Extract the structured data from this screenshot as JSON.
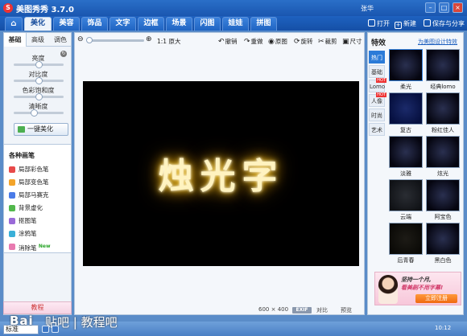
{
  "window": {
    "app_name": "美图秀秀 3.7.0",
    "user": "张华",
    "logo_glyph": "S",
    "minimize": "–",
    "maximize": "□",
    "close": "×"
  },
  "nav": {
    "home_icon": "⌂",
    "tabs": [
      "美化",
      "美容",
      "饰品",
      "文字",
      "边框",
      "场景",
      "闪图",
      "娃娃",
      "拼图"
    ],
    "active_tab": "美化",
    "open_label": "打开",
    "new_label": "新建",
    "save_label": "保存与分享"
  },
  "left": {
    "subtabs": [
      "基础",
      "高级",
      "调色"
    ],
    "sliders": [
      {
        "label": "亮度",
        "value": 0.5
      },
      {
        "label": "对比度",
        "value": 0.5
      },
      {
        "label": "色彩饱和度",
        "value": 0.5
      },
      {
        "label": "清晰度",
        "value": 0.4
      }
    ],
    "one_key": "一键美化",
    "brushes_title": "各种画笔",
    "brushes": [
      {
        "label": "局部彩色笔",
        "color": "#e84a4a",
        "new": false
      },
      {
        "label": "局部变色笔",
        "color": "#f3a42a",
        "new": false
      },
      {
        "label": "局部马赛克",
        "color": "#4a7be8",
        "new": false
      },
      {
        "label": "背景虚化",
        "color": "#52b84c",
        "new": false
      },
      {
        "label": "抠图笔",
        "color": "#9a6ad8",
        "new": false
      },
      {
        "label": "涂鸦笔",
        "color": "#3ab0d8",
        "new": false
      },
      {
        "label": "消除笔",
        "color": "#e87ab0",
        "new": true
      }
    ],
    "new_tag": "New",
    "tutorial": "教程"
  },
  "toolbar": {
    "zoom_out_icon": "⊖",
    "zoom_in_icon": "⊕",
    "actual_size": "1:1 原大",
    "undo": "撤销",
    "redo": "重做",
    "original": "原图",
    "rotate": "旋转",
    "crop": "裁剪",
    "resize": "尺寸",
    "zoom_value": 0.0
  },
  "canvas": {
    "text": "烛光字",
    "width_px": "600",
    "times": "×",
    "height_px": "400",
    "exif": "EXIF",
    "compare": "对比",
    "preview": "预览"
  },
  "effects": {
    "title": "特效",
    "link": "为美图设计特效",
    "categories": [
      {
        "label": "热门",
        "active": true,
        "hot": false
      },
      {
        "label": "基础",
        "active": false,
        "hot": false
      },
      {
        "label": "Lomo",
        "active": false,
        "hot": true
      },
      {
        "label": "人像",
        "active": false,
        "hot": true
      },
      {
        "label": "时尚",
        "active": false,
        "hot": false
      },
      {
        "label": "艺术",
        "active": false,
        "hot": false
      }
    ],
    "hot_tag": "HOT",
    "thumbs": [
      {
        "label": "柔光",
        "style": "tint"
      },
      {
        "label": "经典lomo",
        "style": "tint"
      },
      {
        "label": "复古",
        "style": "blue"
      },
      {
        "label": "粉红佳人",
        "style": "tint"
      },
      {
        "label": "淡雅",
        "style": "tint"
      },
      {
        "label": "炫光",
        "style": "tint"
      },
      {
        "label": "云端",
        "style": "gray"
      },
      {
        "label": "阿宝色",
        "style": "tint"
      },
      {
        "label": "后青春",
        "style": "sepia"
      },
      {
        "label": "黑白色",
        "style": "tint"
      }
    ]
  },
  "ad": {
    "line1": "坚持一个月,",
    "line2": "看美剧不用字幕!",
    "button": "立即注册"
  },
  "bottom": {
    "ime": "标准",
    "watermark_a": "Bai",
    "watermark_b": "贴吧 | 教程吧",
    "tray": "10:12"
  }
}
